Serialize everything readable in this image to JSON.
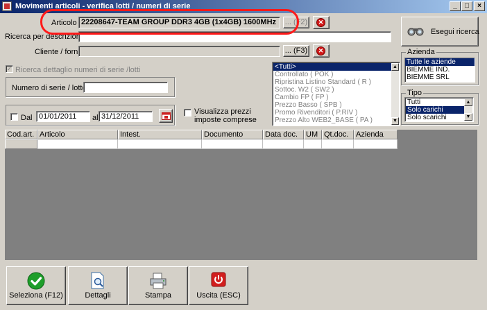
{
  "window": {
    "title": "Movimenti articoli - verifica lotti / numeri di serie",
    "controls": [
      "_",
      "□",
      "×"
    ]
  },
  "filters": {
    "articolo_label": "Articolo :",
    "articolo_value": "22208647-TEAM GROUP DDR3 4GB (1x4GB) 1600MHz",
    "articolo_lookup": "... (F2)",
    "ricerca_label": "Ricerca per descrizione :",
    "ricerca_value": "",
    "cliente_label": "Cliente / forn. :",
    "cliente_value": "",
    "cliente_lookup": "... (F3)",
    "dettaglio_label": "Ricerca dettaglio numeri di serie /lotti",
    "seriale_label": "Numero di serie / lotto :",
    "seriale_value": "",
    "dal_label": "Dal",
    "dal_value": "01/01/2011",
    "al_label": "al",
    "al_value": "31/12/2011",
    "prezzi_label": "Visualizza prezzi imposte comprese"
  },
  "search_button": "Esegui ricerca",
  "listini": [
    "<Tutti>",
    "Controllato ( POK )",
    "Ripristina Listino Standard ( R )",
    "Sottoc. W2 ( SW2 )",
    "Cambio FP ( FP )",
    "Prezzo Basso ( SPB )",
    "Promo Rivenditori ( P.RIV )",
    "Prezzo Alto WEB2_BASE ( PA )"
  ],
  "azienda": {
    "title": "Azienda",
    "items": [
      "Tutte le aziende",
      "BIEMME IND.",
      "BIEMME SRL"
    ]
  },
  "tipo": {
    "title": "Tipo",
    "items": [
      "Tutti",
      "Solo carichi",
      "Solo scarichi"
    ]
  },
  "grid": {
    "columns": [
      "Cod.art.",
      "Articolo",
      "Intest.",
      "Documento",
      "Data doc.",
      "UM",
      "Qt.doc.",
      "Azienda"
    ]
  },
  "actions": {
    "seleziona": "Seleziona (F12)",
    "dettagli": "Dettagli",
    "stampa": "Stampa",
    "uscita": "Uscita (ESC)"
  },
  "colors": {
    "titlebar": "#0a246a",
    "selection": "#0a246a",
    "annotation": "#ff1a1a",
    "grid_bg": "#808080",
    "face": "#d4d0c8"
  },
  "icons": {
    "search": "binoculars-icon",
    "select": "green-check-icon",
    "details": "document-magnifier-icon",
    "print": "printer-icon",
    "exit": "red-power-icon"
  }
}
